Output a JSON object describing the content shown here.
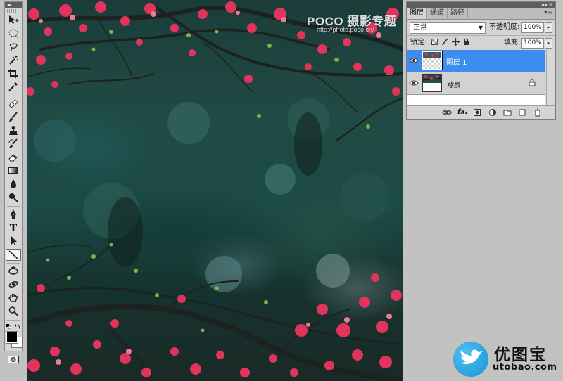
{
  "toolbox": {
    "header_glyph": "◂◂",
    "tools": [
      {
        "name": "move-tool-icon"
      },
      {
        "name": "elliptical-marquee-tool-icon"
      },
      {
        "name": "lasso-tool-icon"
      },
      {
        "name": "magic-wand-tool-icon"
      },
      {
        "name": "crop-tool-icon"
      },
      {
        "name": "eyedropper-tool-icon"
      },
      {
        "name": "healing-brush-tool-icon"
      },
      {
        "name": "brush-tool-icon"
      },
      {
        "name": "clone-stamp-tool-icon"
      },
      {
        "name": "history-brush-tool-icon"
      },
      {
        "name": "eraser-tool-icon"
      },
      {
        "name": "gradient-tool-icon"
      },
      {
        "name": "blur-tool-icon"
      },
      {
        "name": "dodge-tool-icon"
      },
      {
        "name": "pen-tool-icon"
      },
      {
        "name": "type-tool-icon"
      },
      {
        "name": "path-selection-tool-icon"
      },
      {
        "name": "line-tool-icon",
        "active": true
      },
      {
        "name": "3d-rotate-tool-icon"
      },
      {
        "name": "3d-orbit-tool-icon"
      },
      {
        "name": "hand-tool-icon"
      },
      {
        "name": "zoom-tool-icon"
      }
    ],
    "type_glyph": "T",
    "foreground_color": "#000000",
    "background_color": "#ffffff"
  },
  "canvas": {
    "watermark_brand": "POCO 摄影专题",
    "watermark_url": "http://photo.poco.cn/"
  },
  "layers_panel": {
    "collapse_glyph": "◂◂",
    "close_glyph": "✕",
    "menu_glyph": "▾≡",
    "tabs": [
      {
        "label": "图层",
        "active": true
      },
      {
        "label": "通道",
        "active": false
      },
      {
        "label": "路径",
        "active": false
      }
    ],
    "blend_mode": "正常",
    "opacity_label": "不透明度:",
    "opacity_value": "100%",
    "lock_label": "锁定:",
    "fill_label": "填充:",
    "fill_value": "100%",
    "layers": [
      {
        "name": "图层 1",
        "visible": true,
        "selected": true,
        "locked": false
      },
      {
        "name": "背景",
        "visible": true,
        "selected": false,
        "locked": true
      }
    ],
    "footer_icons": [
      "link-layers-icon",
      "fx-icon",
      "add-mask-icon",
      "adjustment-layer-icon",
      "new-group-icon",
      "new-layer-icon",
      "delete-layer-icon"
    ],
    "fx_label": "fx."
  },
  "logo": {
    "text": "优图宝",
    "url": "utobao.com",
    "color": "#1b95d9"
  }
}
